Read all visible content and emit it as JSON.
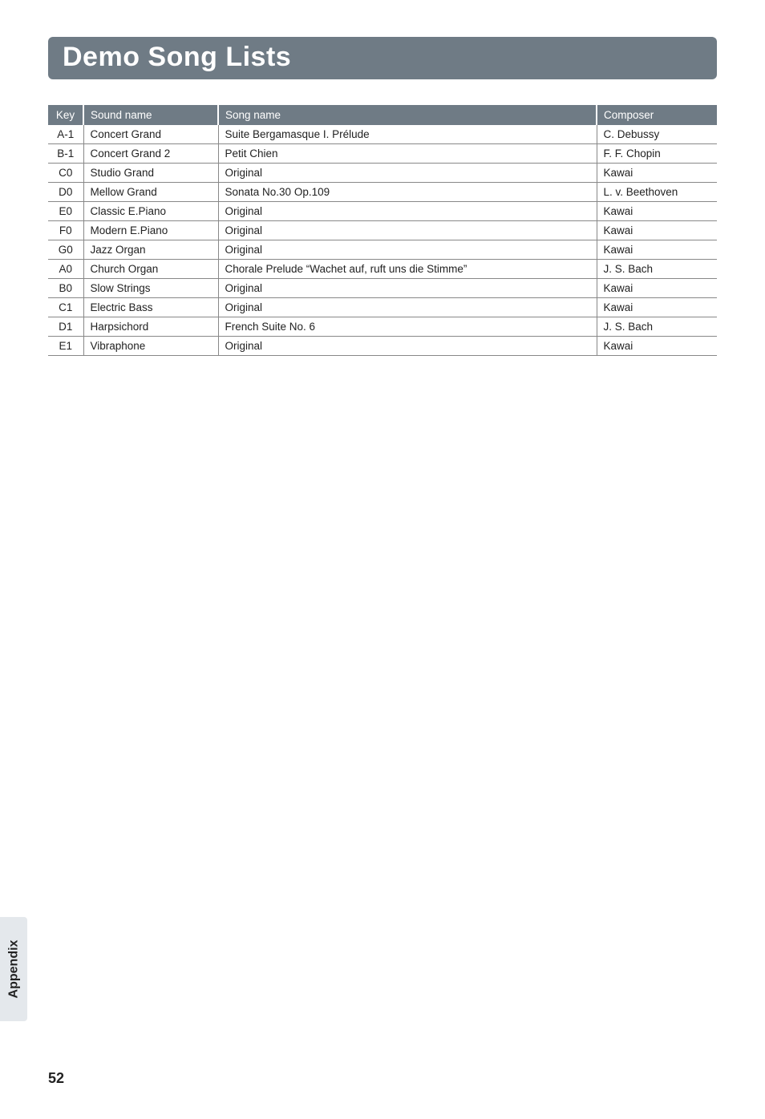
{
  "title": "Demo Song Lists",
  "headers": {
    "key": "Key",
    "sound": "Sound name",
    "song": "Song name",
    "composer": "Composer"
  },
  "rows": [
    {
      "key": "A-1",
      "sound": "Concert Grand",
      "song": "Suite Bergamasque I. Prélude",
      "composer": "C. Debussy"
    },
    {
      "key": "B-1",
      "sound": "Concert Grand 2",
      "song": "Petit Chien",
      "composer": "F. F. Chopin"
    },
    {
      "key": "C0",
      "sound": "Studio Grand",
      "song": "Original",
      "composer": "Kawai"
    },
    {
      "key": "D0",
      "sound": "Mellow Grand",
      "song": "Sonata No.30 Op.109",
      "composer": "L. v. Beethoven"
    },
    {
      "key": "E0",
      "sound": "Classic E.Piano",
      "song": "Original",
      "composer": "Kawai"
    },
    {
      "key": "F0",
      "sound": "Modern E.Piano",
      "song": "Original",
      "composer": "Kawai"
    },
    {
      "key": "G0",
      "sound": "Jazz Organ",
      "song": "Original",
      "composer": "Kawai"
    },
    {
      "key": "A0",
      "sound": "Church Organ",
      "song": "Chorale Prelude “Wachet auf, ruft uns die Stimme”",
      "composer": "J. S. Bach"
    },
    {
      "key": "B0",
      "sound": "Slow Strings",
      "song": "Original",
      "composer": "Kawai"
    },
    {
      "key": "C1",
      "sound": "Electric Bass",
      "song": "Original",
      "composer": "Kawai"
    },
    {
      "key": "D1",
      "sound": "Harpsichord",
      "song": "French Suite No. 6",
      "composer": "J. S. Bach"
    },
    {
      "key": "E1",
      "sound": "Vibraphone",
      "song": "Original",
      "composer": "Kawai"
    }
  ],
  "side_tab": "Appendix",
  "page_number": "52"
}
